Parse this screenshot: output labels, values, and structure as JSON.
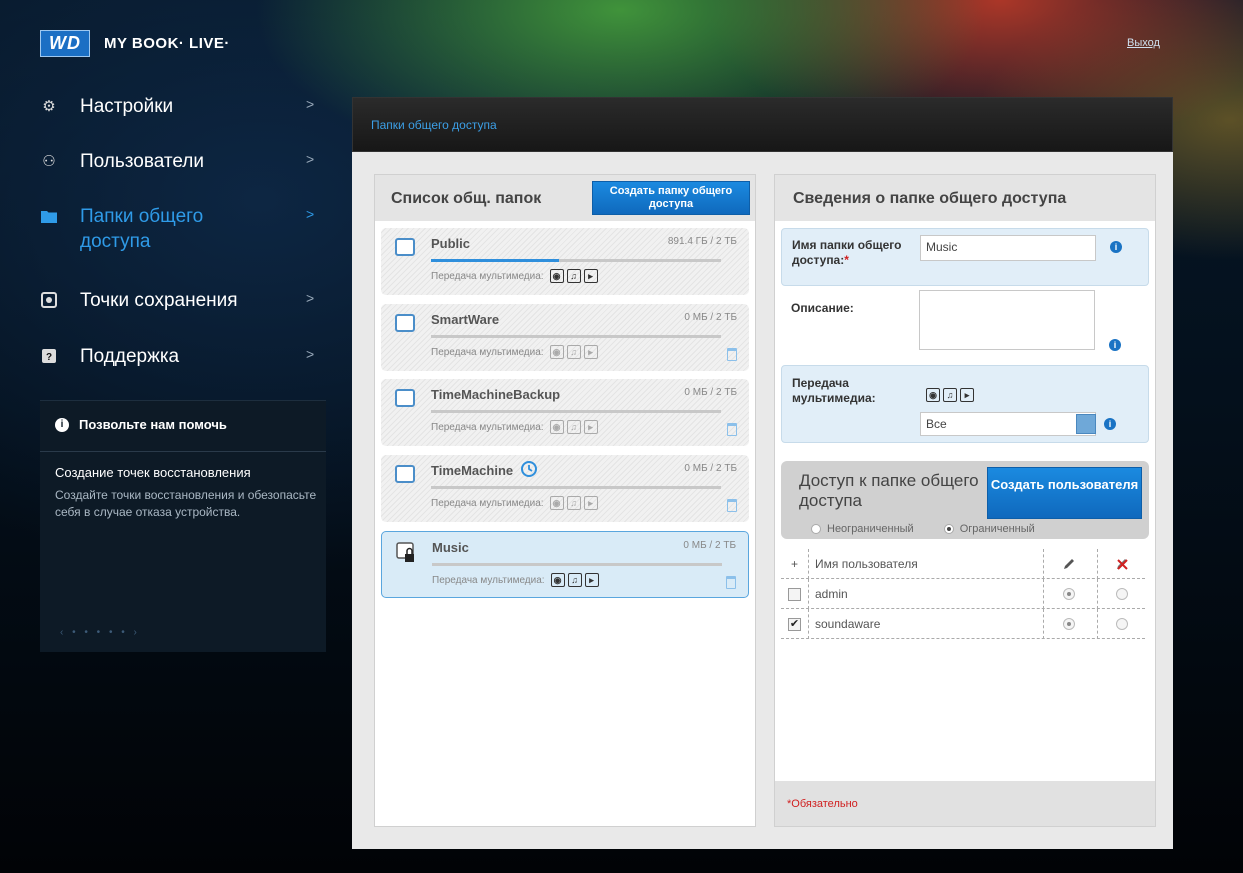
{
  "brand": {
    "logo": "WD",
    "product": "MY BOOK· LIVE·",
    "logout": "Выход"
  },
  "nav": {
    "items": [
      {
        "icon": "gear-icon",
        "label": "Настройки"
      },
      {
        "icon": "users-icon",
        "label": "Пользователи"
      },
      {
        "icon": "folder-icon",
        "label": "Папки общего доступа",
        "active": true
      },
      {
        "icon": "backup-icon",
        "label": "Точки сохранения"
      },
      {
        "icon": "help-icon",
        "label": "Поддержка"
      }
    ],
    "chevron": ">"
  },
  "help": {
    "title": "Позвольте нам помочь",
    "heading": "Создание точек восстановления",
    "body": "Создайте точки восстановления и обезопасьте себя в случае отказа устройства.",
    "pager": "‹ • • • • • ›"
  },
  "main": {
    "header_title": "Папки общего доступа",
    "list_title": "Список общ. папок",
    "create_share_label": "Создать папку общего доступа",
    "media_label": "Передача мультимедиа:",
    "shares": [
      {
        "name": "Public",
        "size": "891.4 ГБ / 2 ТБ",
        "fill_fraction": 0.44,
        "media_active": true,
        "deletable": false,
        "selected": false
      },
      {
        "name": "SmartWare",
        "size": "0 МБ / 2 ТБ",
        "fill_fraction": 0,
        "media_active": false,
        "deletable": true,
        "selected": false
      },
      {
        "name": "TimeMachineBackup",
        "size": "0 МБ / 2 ТБ",
        "fill_fraction": 0,
        "media_active": false,
        "deletable": true,
        "selected": false
      },
      {
        "name": "TimeMachine",
        "size": "0 МБ / 2 ТБ",
        "fill_fraction": 0,
        "media_active": false,
        "deletable": true,
        "selected": false
      },
      {
        "name": "Music",
        "size": "0 МБ / 2 ТБ",
        "fill_fraction": 0,
        "media_active": true,
        "deletable": true,
        "selected": true
      }
    ]
  },
  "details": {
    "title": "Сведения о папке общего доступа",
    "name_label": "Имя папки общего доступа:",
    "name_required": "*",
    "name_value": "Music",
    "description_label": "Описание:",
    "description_value": "",
    "media_label": "Передача мультимедиа:",
    "media_select_value": "Все",
    "access_title": "Доступ к папке общего доступа",
    "create_user_label": "Создать пользователя",
    "radio_unrestricted": "Неограниченный",
    "radio_restricted": "Ограниченный",
    "restricted_selected": true,
    "table_add": "+",
    "table_header_user": "Имя пользователя",
    "users": [
      {
        "name": "admin",
        "checked": false,
        "rw": true,
        "none": false
      },
      {
        "name": "soundaware",
        "checked": true,
        "rw": true,
        "none": false
      }
    ],
    "required_note": "*Обязательно"
  },
  "colors": {
    "accent": "#2f9be8",
    "button": "#1b7dd4",
    "required": "#d02020"
  }
}
